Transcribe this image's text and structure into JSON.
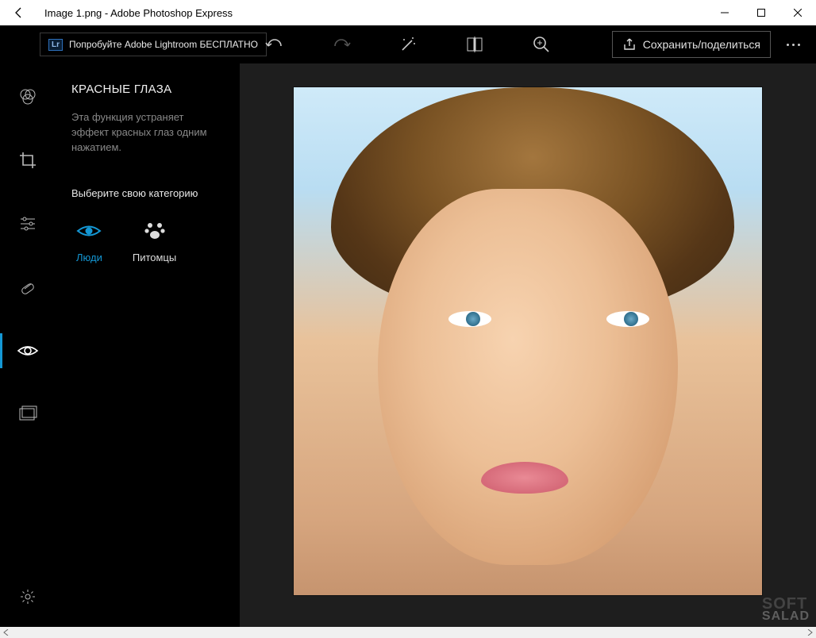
{
  "window": {
    "title": "Image 1.png - Adobe Photoshop Express"
  },
  "toolbar": {
    "lightroom_badge": "Lr",
    "lightroom_promo": "Попробуйте Adobe Lightroom БЕСПЛАТНО",
    "save_share_label": "Сохранить/поделиться"
  },
  "panel": {
    "title": "КРАСНЫЕ ГЛАЗА",
    "description": "Эта функция устраняет эффект красных глаз одним нажатием.",
    "choose_label": "Выберите свою категорию",
    "categories": [
      {
        "id": "people",
        "label": "Люди",
        "selected": true
      },
      {
        "id": "pets",
        "label": "Питомцы",
        "selected": false
      }
    ]
  },
  "watermark": {
    "line1": "SOFT",
    "line2": "SALAD"
  },
  "colors": {
    "accent": "#1497d4"
  }
}
